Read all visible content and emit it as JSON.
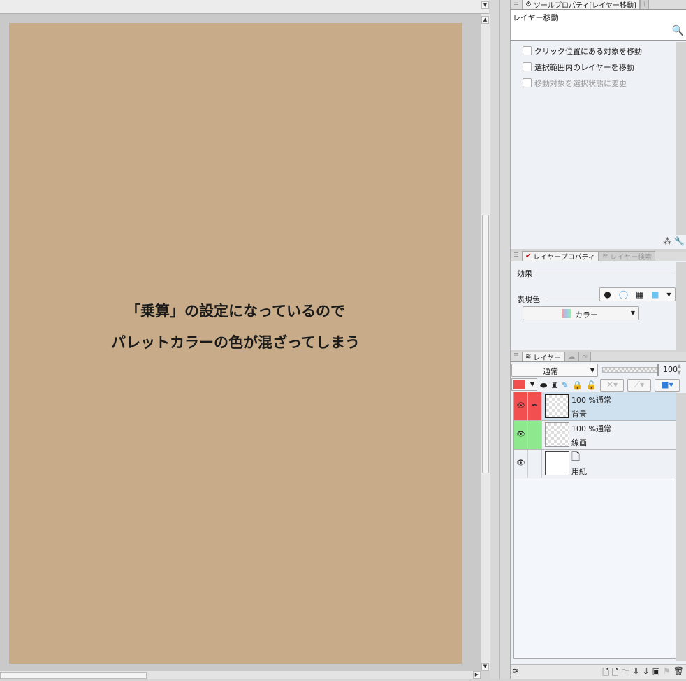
{
  "canvas": {
    "caption_line1": "「乗算」の設定になっているので",
    "caption_line2": "パレットカラーの色が混ざってしまう",
    "paper_color": "#c8ab88"
  },
  "tool_property": {
    "tab_label": "ツールプロパティ[レイヤー移動]",
    "tool_name": "レイヤー移動",
    "options": [
      {
        "label": "クリック位置にある対象を移動",
        "checked": false,
        "enabled": true
      },
      {
        "label": "選択範囲内のレイヤーを移動",
        "checked": false,
        "enabled": true
      },
      {
        "label": "移動対象を選択状態に変更",
        "checked": false,
        "enabled": false
      }
    ]
  },
  "layer_property": {
    "tab_label": "レイヤープロパティ",
    "tab2_label": "レイヤー検索",
    "effect_label": "効果",
    "expression_label": "表現色",
    "expression_value": "カラー"
  },
  "layers": {
    "tab_label": "レイヤー",
    "blend_mode": "通常",
    "opacity": "100",
    "layer_color": "#f25050",
    "items": [
      {
        "mode": "100 %通常",
        "name": "背景",
        "color": "#f25050",
        "selected": true,
        "visible": true
      },
      {
        "mode": "100 %通常",
        "name": "線画",
        "color": "#8ee88e",
        "selected": false,
        "visible": true
      },
      {
        "mode": "",
        "name": "用紙",
        "color": "",
        "selected": false,
        "visible": true
      }
    ]
  }
}
